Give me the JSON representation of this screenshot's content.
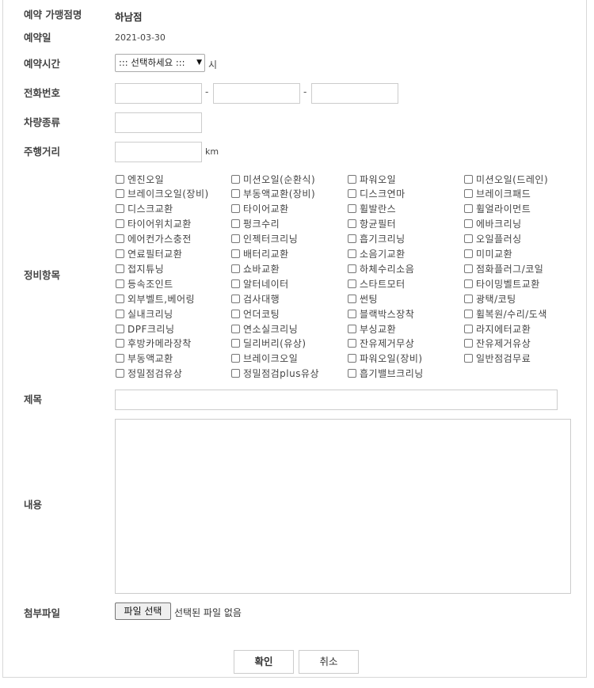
{
  "form": {
    "store_label": "예약 가맹점명",
    "store_value": "하남점",
    "date_label": "예약일",
    "date_value": "2021-03-30",
    "time_label": "예약시간",
    "time_select_value": "::: 선택하세요 :::",
    "time_unit": "시",
    "phone_label": "전화번호",
    "phone_separator": "-",
    "vehicle_label": "차량종류",
    "mileage_label": "주행거리",
    "mileage_unit": "km",
    "service_label": "정비항목",
    "title_label": "제목",
    "content_label": "내용",
    "attach_label": "첨부파일",
    "file_button": "파일 선택",
    "file_status": "선택된 파일 없음"
  },
  "service_items": [
    [
      "엔진오일",
      "미션오일(순환식)",
      "파워오일",
      "미션오일(드레인)"
    ],
    [
      "브레이크오일(장비)",
      "부동액교환(장비)",
      "디스크연마",
      "브레이크패드"
    ],
    [
      "디스크교환",
      "타이어교환",
      "휠발란스",
      "휠얼라이먼트"
    ],
    [
      "타이어위치교환",
      "펑크수리",
      "항균필터",
      "에바크리닝"
    ],
    [
      "에어컨가스충전",
      "인젝터크리닝",
      "흡기크리닝",
      "오일플러싱"
    ],
    [
      "연료필터교환",
      "배터리교환",
      "소음기교환",
      "미미교환"
    ],
    [
      "접지튜닝",
      "쇼바교환",
      "하체수리소음",
      "점화플러그/코일"
    ],
    [
      "등속조인트",
      "알터네이터",
      "스타트모터",
      "타이밍벨트교환"
    ],
    [
      "외부벨트,베어링",
      "검사대행",
      "썬팅",
      "광택/코팅"
    ],
    [
      "실내크리닝",
      "언더코팅",
      "블랙박스장착",
      "휠복원/수리/도색"
    ],
    [
      "DPF크리닝",
      "연소실크리닝",
      "부싱교환",
      "라지에터교환"
    ],
    [
      "후방카메라장착",
      "딜리버리(유상)",
      "잔유제거무상",
      "잔유제거유상"
    ],
    [
      "부동액교환",
      "브레이크오일",
      "파워오일(장비)",
      "일반점검무료"
    ],
    [
      "정밀점검유상",
      "정밀점검plus유상",
      "흡기밸브크리닝"
    ]
  ],
  "buttons": {
    "confirm": "확인",
    "cancel": "취소"
  }
}
